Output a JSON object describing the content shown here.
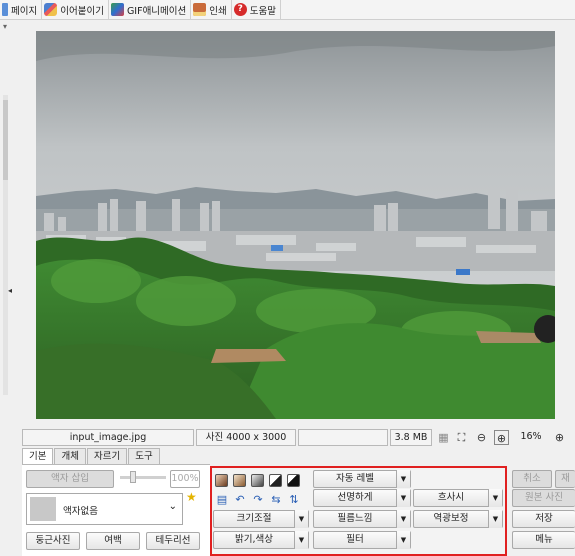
{
  "toolbar": {
    "items": [
      {
        "label": "페이지",
        "icon": "page-icon"
      },
      {
        "label": "이어붙이기",
        "icon": "pencil-icon"
      },
      {
        "label": "GIF애니메이션",
        "icon": "gif-icon"
      },
      {
        "label": "인쇄",
        "icon": "print-icon"
      },
      {
        "label": "도움말",
        "icon": "help-icon"
      }
    ]
  },
  "status": {
    "filename": "input_image.jpg",
    "dimensions": "사진 4000 x 3000",
    "filesize": "3.8 MB",
    "zoom": "16%"
  },
  "panel": {
    "tabs": [
      "기본",
      "개체",
      "자르기",
      "도구"
    ],
    "frame_insert_label": "액자 삽입",
    "frame_percent": "100%",
    "frame_select_value": "액자없음",
    "round_photo_label": "둥근사진",
    "margin_label": "여백",
    "border_label": "테두리선",
    "auto_level_label": "자동 레벨",
    "sharpen_label": "선명하게",
    "blur_label": "흐사시",
    "resize_label": "크기조절",
    "film_feel_label": "필름느낌",
    "backlight_label": "역광보정",
    "brightness_label": "밝기,색상",
    "filter_label": "필터",
    "cancel_label": "취소",
    "redo_label": "재",
    "original_label": "원본 사진",
    "save_label": "저장",
    "menu_label": "메뉴"
  },
  "colors": {
    "highlight_border": "#e02020",
    "sky": "#c8cacb",
    "foliage": "#3d7a2c"
  }
}
